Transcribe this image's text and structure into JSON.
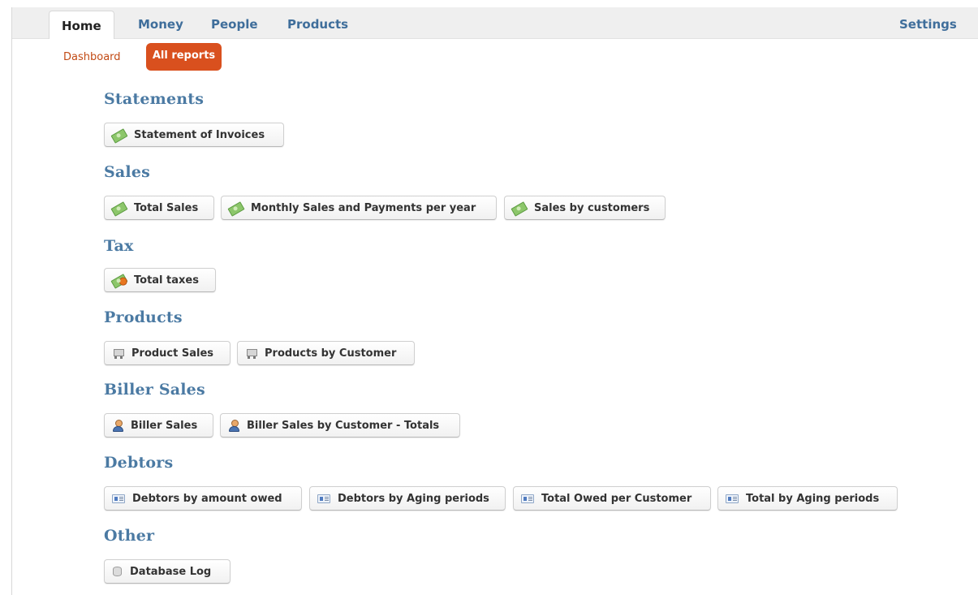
{
  "tabs": {
    "home": "Home",
    "money": "Money",
    "people": "People",
    "products": "Products",
    "settings": "Settings"
  },
  "subnav": {
    "dashboard": "Dashboard",
    "all_reports": "All reports"
  },
  "sections": {
    "statements": {
      "title": "Statements",
      "buttons": [
        "Statement of Invoices"
      ]
    },
    "sales": {
      "title": "Sales",
      "buttons": [
        "Total Sales",
        "Monthly Sales and Payments per year",
        "Sales by customers"
      ]
    },
    "tax": {
      "title": "Tax",
      "buttons": [
        "Total taxes"
      ]
    },
    "products": {
      "title": "Products",
      "buttons": [
        "Product Sales",
        "Products by Customer"
      ]
    },
    "biller": {
      "title": "Biller Sales",
      "buttons": [
        "Biller Sales",
        "Biller Sales by Customer - Totals"
      ]
    },
    "debtors": {
      "title": "Debtors",
      "buttons": [
        "Debtors by amount owed",
        "Debtors by Aging periods",
        "Total Owed per Customer",
        "Total by Aging periods"
      ]
    },
    "other": {
      "title": "Other",
      "buttons": [
        "Database Log"
      ]
    }
  },
  "icons": {
    "statements": "money-icon",
    "sales": "money-icon",
    "tax": "money-tax-icon",
    "products": "cart-icon",
    "biller": "user-icon",
    "debtors": "card-icon",
    "other": "database-icon"
  },
  "colors": {
    "accent": "#d9501e",
    "link": "#3f6e9b",
    "heading": "#4b7aa3"
  }
}
